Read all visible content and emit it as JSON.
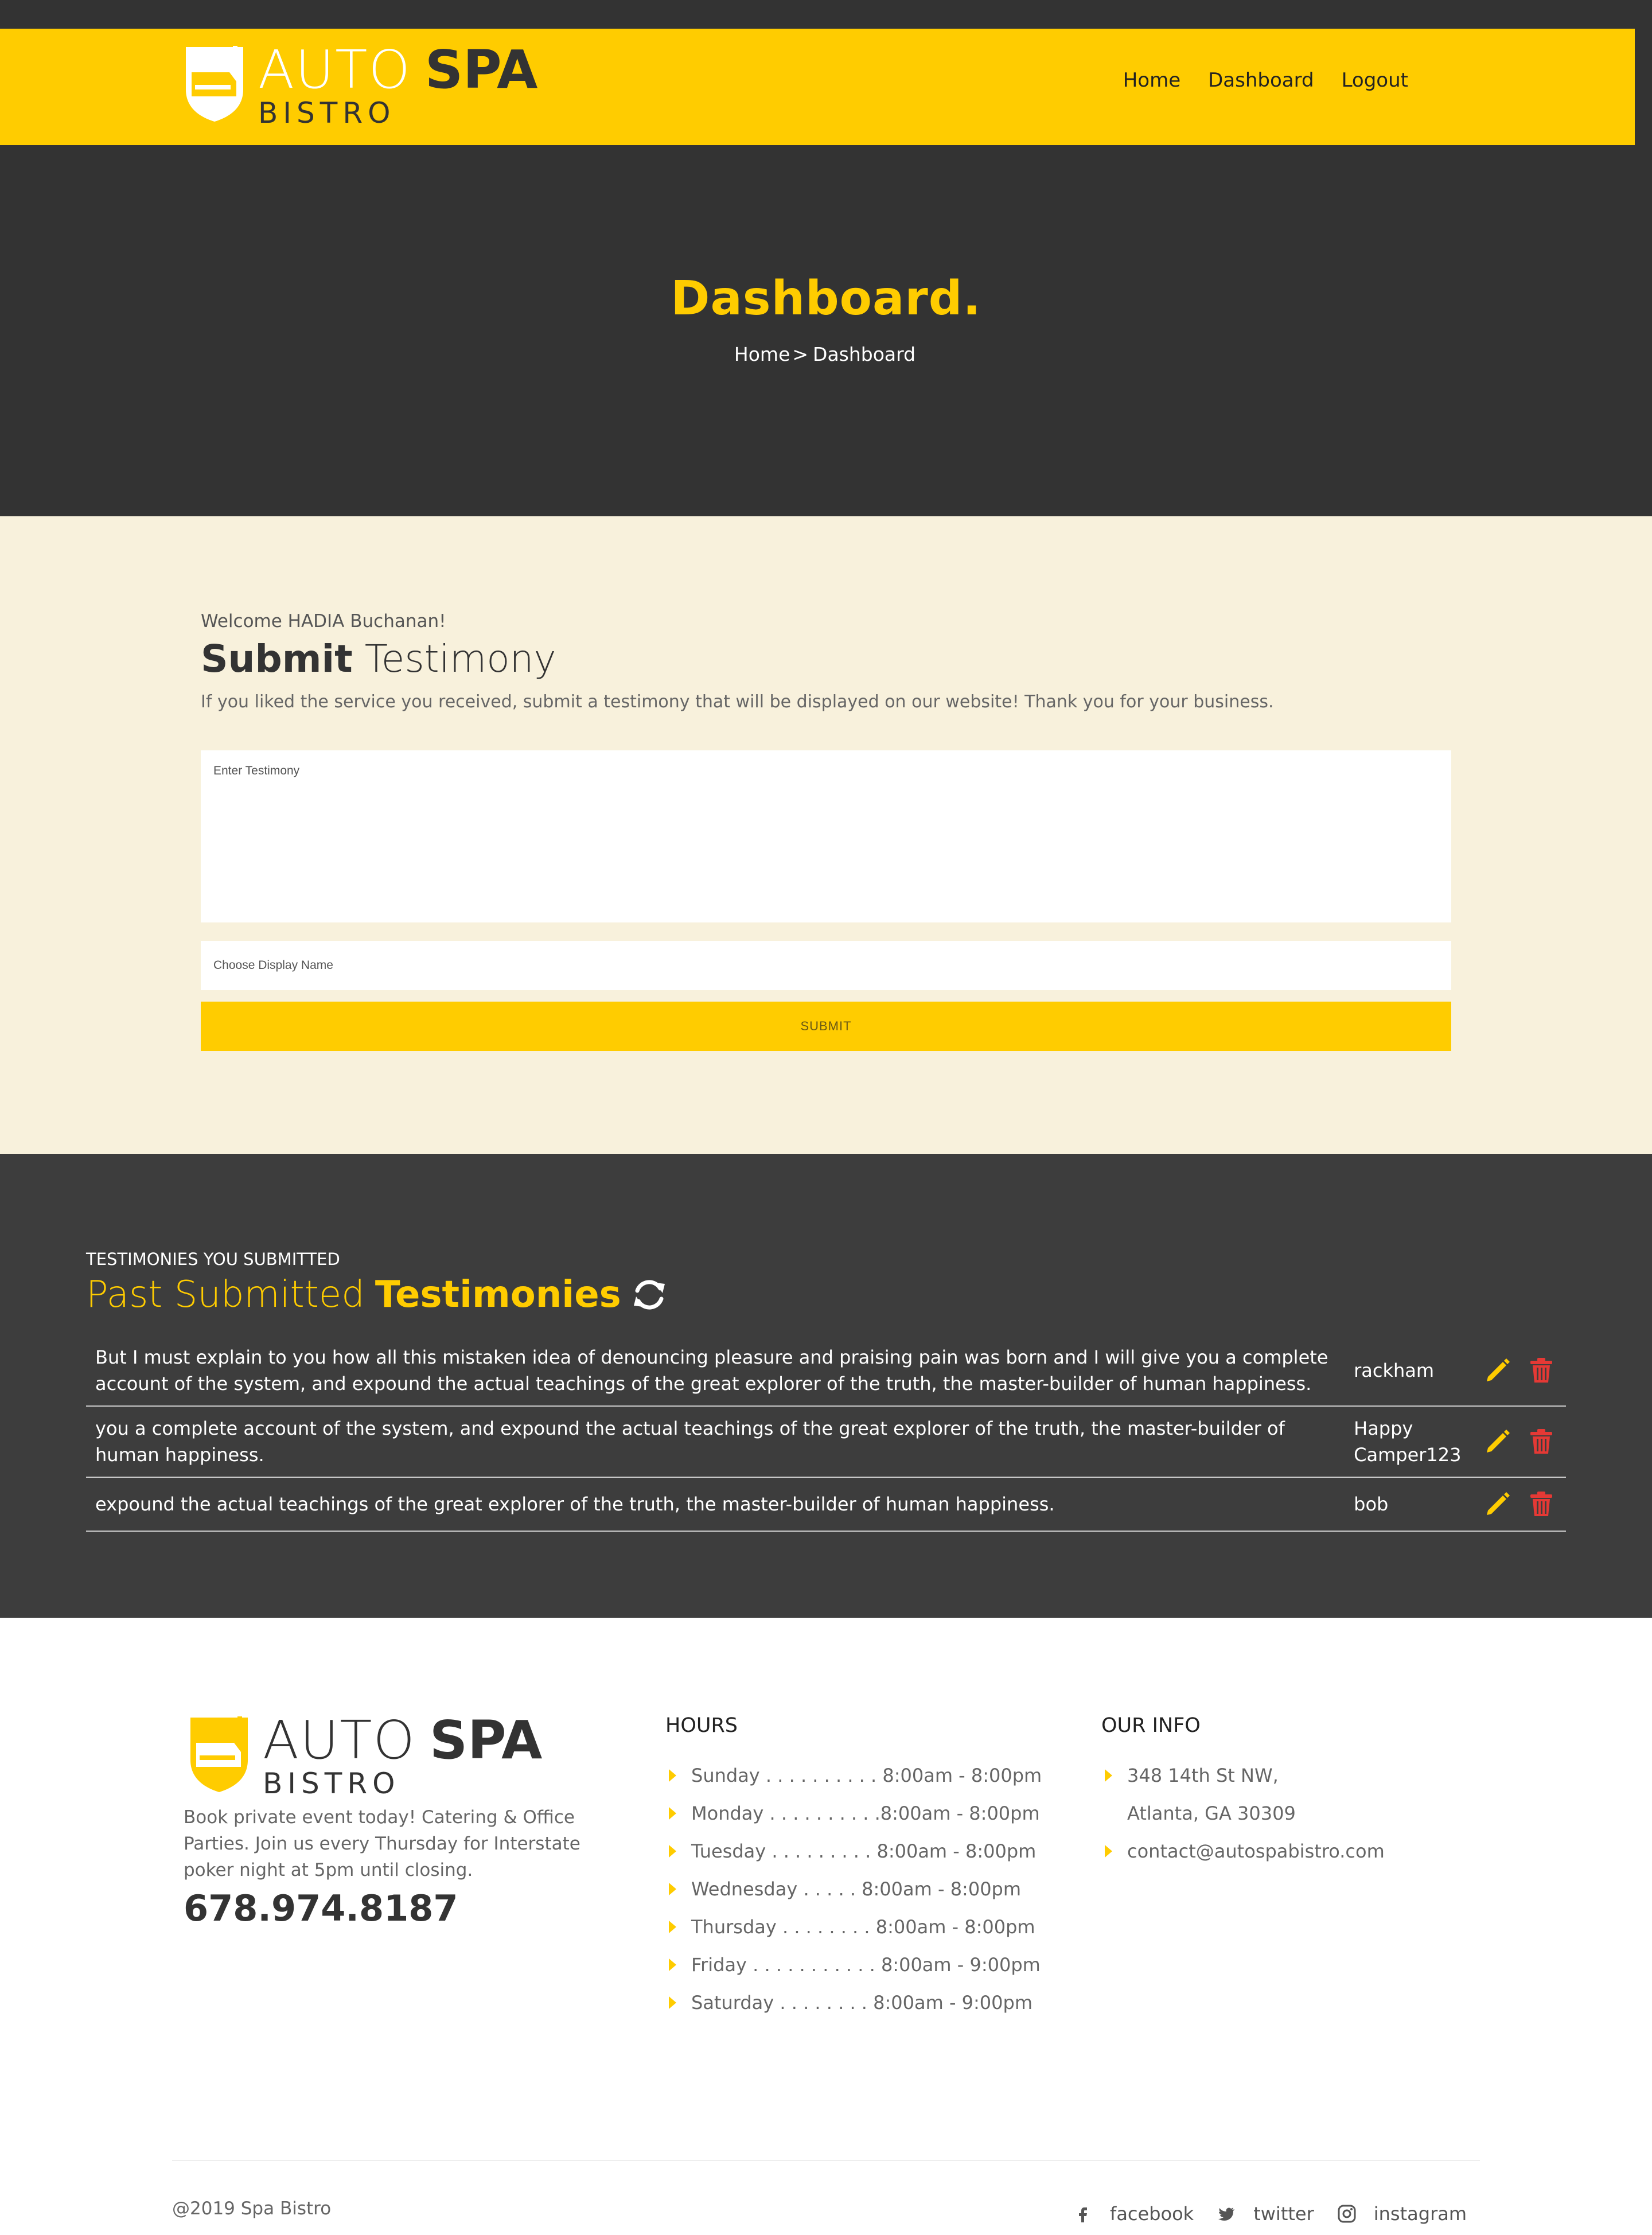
{
  "brand": {
    "auto": "AUTO",
    "spa": "SPA",
    "bistro": "BISTRO"
  },
  "nav": {
    "home": "Home",
    "dashboard": "Dashboard",
    "logout": "Logout"
  },
  "hero": {
    "title": "Dashboard.",
    "crumb_home": "Home",
    "crumb_sep": ">",
    "crumb_current": "Dashboard"
  },
  "submit": {
    "welcome": "Welcome HADIA Buchanan!",
    "heading_bold": "Submit",
    "heading_light": "Testimony",
    "intro": "If you liked the service you received, submit a testimony that will be displayed on our website! Thank you for your business.",
    "testimony_placeholder": "Enter Testimony",
    "name_placeholder": "Choose Display Name",
    "button": "SUBMIT"
  },
  "past": {
    "kicker": "TESTIMONIES YOU SUBMITTED",
    "title_light": "Past Submitted",
    "title_bold": "Testimonies",
    "rows": [
      {
        "text": "But I must explain to you how all this mistaken idea of denouncing pleasure and praising pain was born and I will give you a complete account of the system, and expound the actual teachings of the great explorer of the truth, the master-builder of human happiness.",
        "name": "rackham"
      },
      {
        "text": "you a complete account of the system, and expound the actual teachings of the great explorer of the truth, the master-builder of human happiness.",
        "name": "Happy Camper123"
      },
      {
        "text": "expound the actual teachings of the great explorer of the truth, the master-builder of human happiness.",
        "name": "bob"
      }
    ]
  },
  "footer": {
    "about": "Book private event today! Catering & Office Parties. Join us every Thursday for Interstate poker night at 5pm until closing.",
    "phone": "678.974.8187",
    "hours_title": "HOURS",
    "hours": [
      "Sunday . . . . . . . . . . 8:00am - 8:00pm",
      "Monday . . . . . . . . . .8:00am - 8:00pm",
      "Tuesday . . . . . . . . . 8:00am - 8:00pm",
      "Wednesday . . . . . 8:00am - 8:00pm",
      "Thursday . . . . . . . . 8:00am - 8:00pm",
      "Friday . . . . . . . . . . . 8:00am - 9:00pm",
      "Saturday . . . . . . . . 8:00am - 9:00pm"
    ],
    "info_title": "OUR INFO",
    "address_line1": "348 14th St NW,",
    "address_line2": "Atlanta, GA 30309",
    "email": "contact@autospabistro.com",
    "copyright": "@2019 Spa Bistro",
    "social": {
      "facebook": "facebook",
      "twitter": "twitter",
      "instagram": "instagram"
    }
  },
  "colors": {
    "accent": "#FFCC00",
    "dark": "#333333",
    "cream": "#F8F1DC",
    "delete": "#E53935"
  }
}
